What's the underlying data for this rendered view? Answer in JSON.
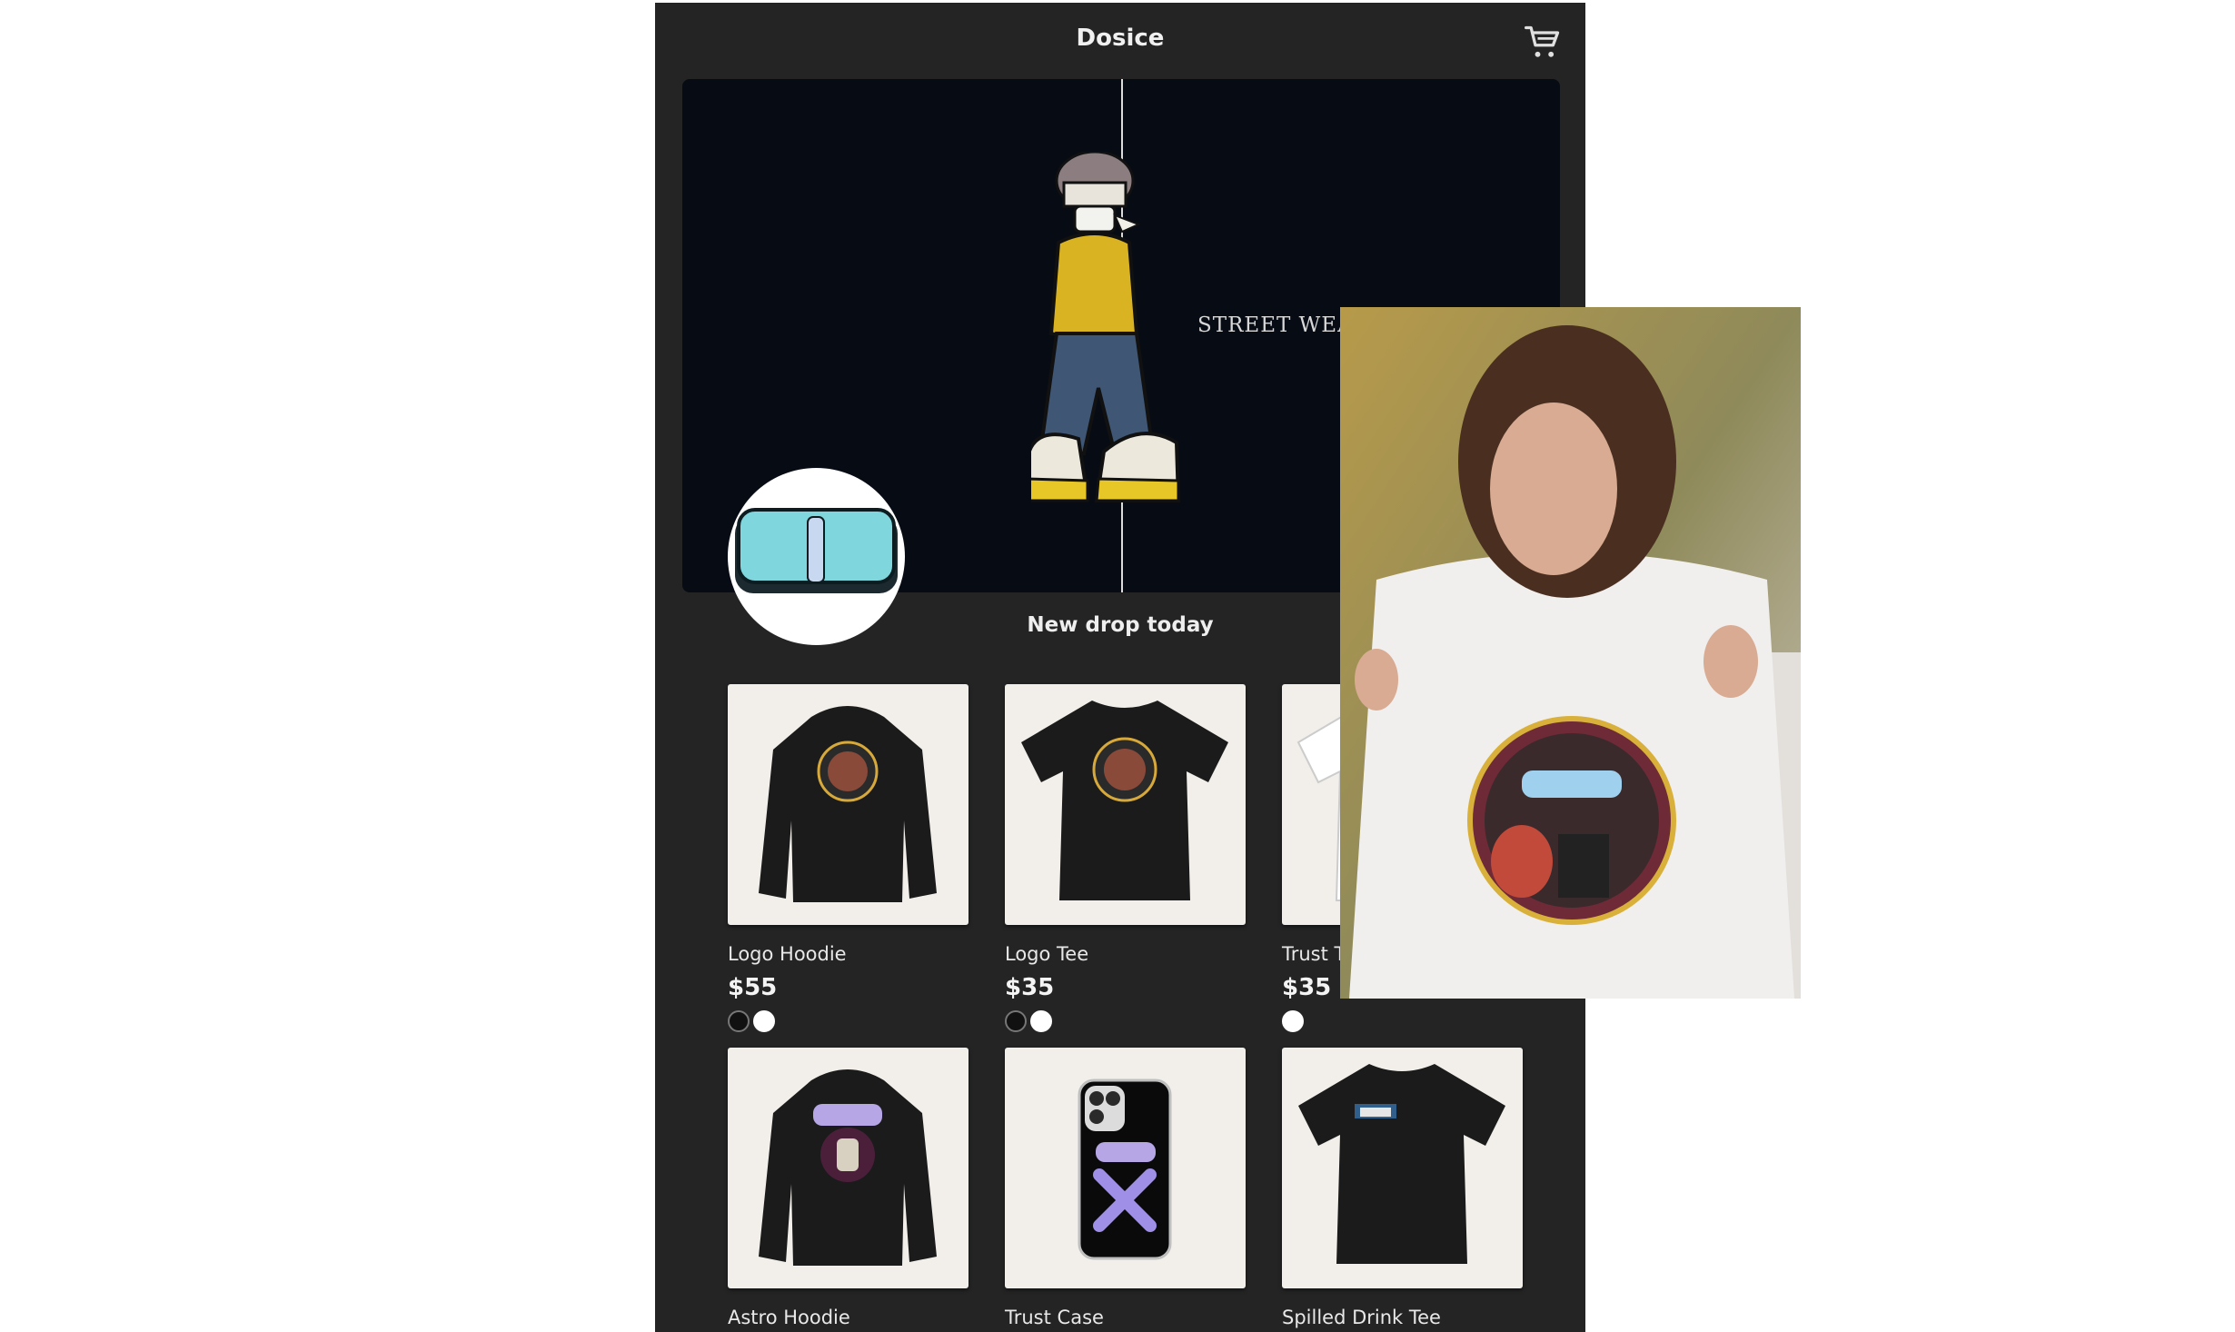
{
  "header": {
    "title": "Dosice",
    "cart_icon": "cart-icon"
  },
  "hero": {
    "tagline": "STREET WEAR"
  },
  "section": {
    "title": "New drop today"
  },
  "colors": {
    "background": "#242424",
    "hero_bg": "#070b14",
    "card_bg": "#f2efeb",
    "text": "#e8e8e8"
  },
  "products": [
    {
      "name": "Logo Hoodie",
      "price": "$55",
      "colors": [
        "black",
        "white"
      ]
    },
    {
      "name": "Logo Tee",
      "price": "$35",
      "colors": [
        "black",
        "white"
      ]
    },
    {
      "name": "Trust Tee",
      "price": "$35",
      "colors": [
        "white"
      ]
    },
    {
      "name": "Astro Hoodie",
      "price": "",
      "colors": []
    },
    {
      "name": "Trust Case",
      "price": "",
      "colors": []
    },
    {
      "name": "Spilled Drink Tee",
      "price": "",
      "colors": []
    }
  ]
}
